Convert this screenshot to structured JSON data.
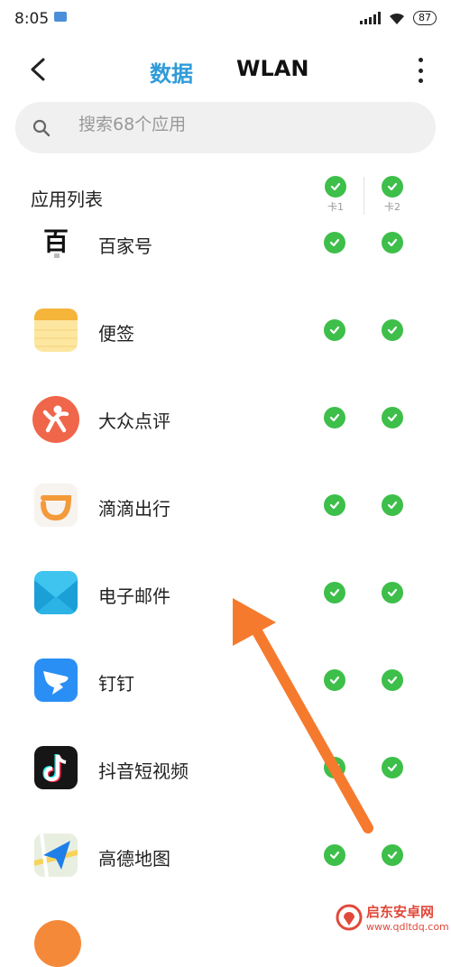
{
  "status": {
    "time": "8:05",
    "battery": "87"
  },
  "header": {
    "tabs": [
      {
        "label": "数据"
      },
      {
        "label": "WLAN"
      }
    ]
  },
  "search": {
    "placeholder": "搜索68个应用"
  },
  "list": {
    "title": "应用列表",
    "columns": [
      {
        "label": "卡1"
      },
      {
        "label": "卡2"
      }
    ],
    "apps": [
      {
        "name": "百家号",
        "sim1": true,
        "sim2": true
      },
      {
        "name": "便签",
        "sim1": true,
        "sim2": true
      },
      {
        "name": "大众点评",
        "sim1": true,
        "sim2": true
      },
      {
        "name": "滴滴出行",
        "sim1": true,
        "sim2": true
      },
      {
        "name": "电子邮件",
        "sim1": true,
        "sim2": true
      },
      {
        "name": "钉钉",
        "sim1": true,
        "sim2": true
      },
      {
        "name": "抖音短视频",
        "sim1": true,
        "sim2": true
      },
      {
        "name": "高德地图",
        "sim1": true,
        "sim2": true
      }
    ]
  },
  "watermark": {
    "name": "启东安卓网",
    "url": "www.qdltdq.com"
  },
  "colors": {
    "accent": "#2f9bd8",
    "check": "#3dbf4a",
    "arrow": "#f57a2e"
  }
}
